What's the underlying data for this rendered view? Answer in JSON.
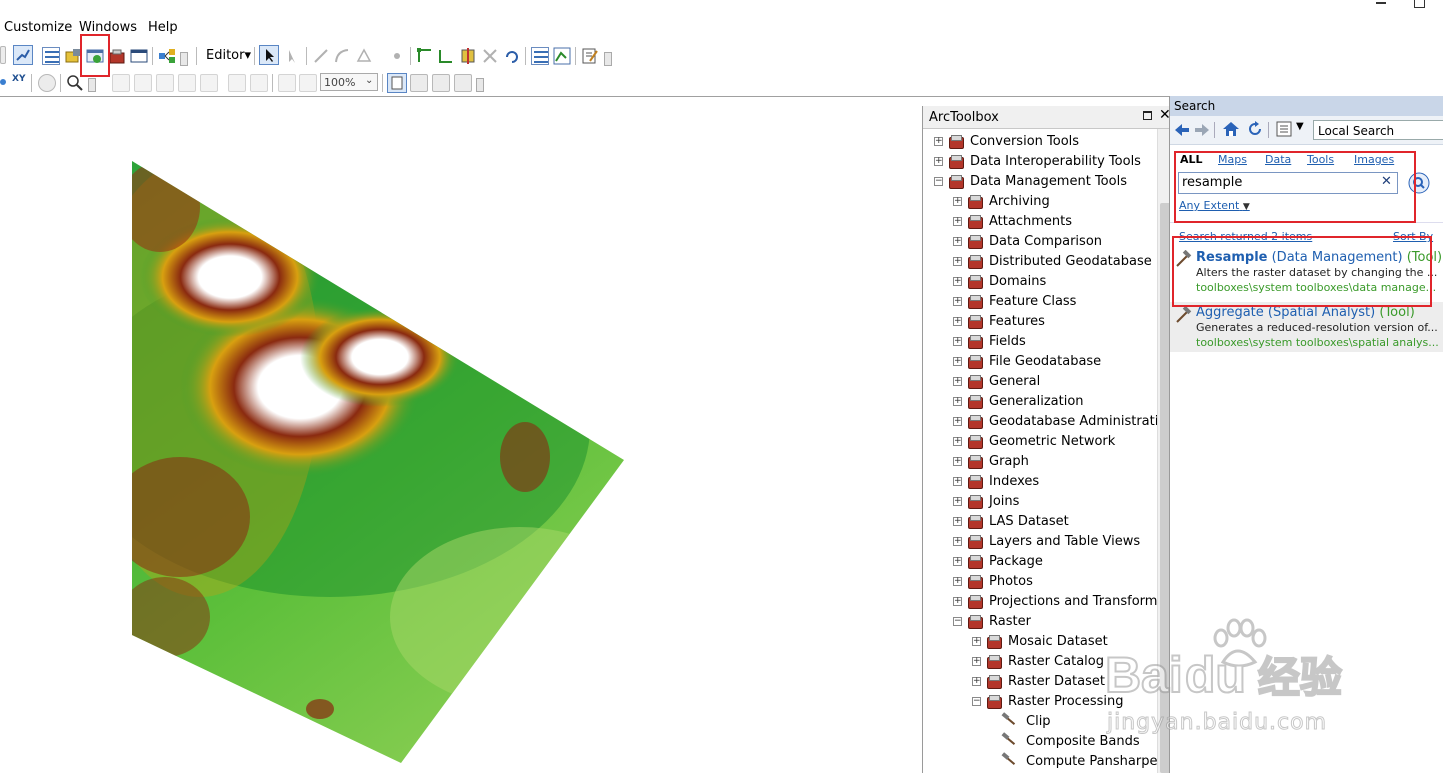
{
  "menubar": {
    "items": [
      "Customize",
      "Windows",
      "Help"
    ]
  },
  "toolbar": {
    "editor_label": "Editor",
    "editor_arrow": "▾",
    "zoom_value": "100%"
  },
  "arctoolbox": {
    "title": "ArcToolbox",
    "tree": [
      {
        "label": "Conversion Tools",
        "level": 0,
        "expander": "+",
        "icon": "toolbox"
      },
      {
        "label": "Data Interoperability Tools",
        "level": 0,
        "expander": "+",
        "icon": "toolbox"
      },
      {
        "label": "Data Management Tools",
        "level": 0,
        "expander": "−",
        "icon": "toolbox"
      },
      {
        "label": "Archiving",
        "level": 1,
        "expander": "+",
        "icon": "toolset"
      },
      {
        "label": "Attachments",
        "level": 1,
        "expander": "+",
        "icon": "toolset"
      },
      {
        "label": "Data Comparison",
        "level": 1,
        "expander": "+",
        "icon": "toolset"
      },
      {
        "label": "Distributed Geodatabase",
        "level": 1,
        "expander": "+",
        "icon": "toolset"
      },
      {
        "label": "Domains",
        "level": 1,
        "expander": "+",
        "icon": "toolset"
      },
      {
        "label": "Feature Class",
        "level": 1,
        "expander": "+",
        "icon": "toolset"
      },
      {
        "label": "Features",
        "level": 1,
        "expander": "+",
        "icon": "toolset"
      },
      {
        "label": "Fields",
        "level": 1,
        "expander": "+",
        "icon": "toolset"
      },
      {
        "label": "File Geodatabase",
        "level": 1,
        "expander": "+",
        "icon": "toolset"
      },
      {
        "label": "General",
        "level": 1,
        "expander": "+",
        "icon": "toolset"
      },
      {
        "label": "Generalization",
        "level": 1,
        "expander": "+",
        "icon": "toolset"
      },
      {
        "label": "Geodatabase Administration",
        "level": 1,
        "expander": "+",
        "icon": "toolset"
      },
      {
        "label": "Geometric Network",
        "level": 1,
        "expander": "+",
        "icon": "toolset"
      },
      {
        "label": "Graph",
        "level": 1,
        "expander": "+",
        "icon": "toolset"
      },
      {
        "label": "Indexes",
        "level": 1,
        "expander": "+",
        "icon": "toolset"
      },
      {
        "label": "Joins",
        "level": 1,
        "expander": "+",
        "icon": "toolset"
      },
      {
        "label": "LAS Dataset",
        "level": 1,
        "expander": "+",
        "icon": "toolset"
      },
      {
        "label": "Layers and Table Views",
        "level": 1,
        "expander": "+",
        "icon": "toolset"
      },
      {
        "label": "Package",
        "level": 1,
        "expander": "+",
        "icon": "toolset"
      },
      {
        "label": "Photos",
        "level": 1,
        "expander": "+",
        "icon": "toolset"
      },
      {
        "label": "Projections and Transformat",
        "level": 1,
        "expander": "+",
        "icon": "toolset"
      },
      {
        "label": "Raster",
        "level": 1,
        "expander": "−",
        "icon": "toolset"
      },
      {
        "label": "Mosaic Dataset",
        "level": 2,
        "expander": "+",
        "icon": "toolset"
      },
      {
        "label": "Raster Catalog",
        "level": 2,
        "expander": "+",
        "icon": "toolset"
      },
      {
        "label": "Raster Dataset",
        "level": 2,
        "expander": "+",
        "icon": "toolset"
      },
      {
        "label": "Raster Processing",
        "level": 2,
        "expander": "−",
        "icon": "toolset"
      },
      {
        "label": "Clip",
        "level": 3,
        "expander": "",
        "icon": "hammer"
      },
      {
        "label": "Composite Bands",
        "level": 3,
        "expander": "",
        "icon": "hammer"
      },
      {
        "label": "Compute Pansharpen",
        "level": 3,
        "expander": "",
        "icon": "hammer"
      }
    ]
  },
  "search": {
    "title": "Search",
    "scope_label": "Local Search",
    "categories": [
      "ALL",
      "Maps",
      "Data",
      "Tools",
      "Images"
    ],
    "query": "resample",
    "clear_glyph": "✕",
    "extent_label": "Any Extent",
    "summary_left": "Search returned 2 items",
    "summary_right": "Sort By",
    "results": [
      {
        "name": "Resample",
        "category": "(Data Management)",
        "kind": "(Tool)",
        "description": "Alters the raster dataset by changing the ...",
        "path": "toolboxes\\system toolboxes\\data manage..."
      },
      {
        "name": "Aggregate",
        "category": "(Spatial Analyst)",
        "kind": "(Tool)",
        "description": "Generates a reduced-resolution version of...",
        "path": "toolboxes\\system toolboxes\\spatial analys..."
      }
    ]
  },
  "watermark": {
    "brand_latin": "Bai",
    "brand_du": "du",
    "brand_cn": "经验",
    "url": "jingyan.baidu.com"
  },
  "colors": {
    "link": "#1f5fb0",
    "path_green": "#3a9a2a",
    "highlight_red": "#e0252b",
    "tool_blue": "#1f5fb0"
  }
}
